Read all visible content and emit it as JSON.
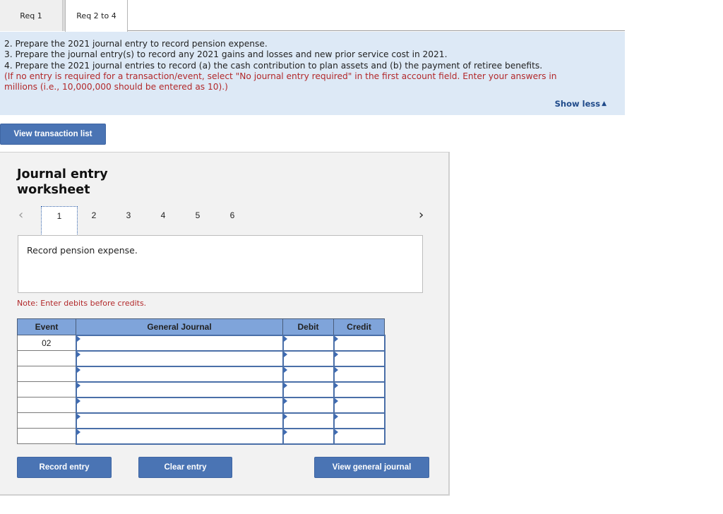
{
  "tabs": [
    {
      "label": "Req 1",
      "active": false
    },
    {
      "label": "Req 2 to 4",
      "active": true
    }
  ],
  "instructions": {
    "lines": [
      "2. Prepare the 2021 journal entry to record pension expense.",
      "3. Prepare the journal entry(s) to record any 2021 gains and losses and new prior service cost in 2021.",
      "4. Prepare the 2021 journal entries to record (a) the cash contribution to plan assets and (b) the payment of retiree benefits."
    ],
    "note_line1": "(If no entry is required for a transaction/event, select \"No journal entry required\" in the first account field. Enter your answers in",
    "note_line2": "millions (i.e., 10,000,000 should be entered as 10).)",
    "show_less_label": "Show less",
    "show_less_icon": "triangle-up-icon"
  },
  "view_transaction_list_label": "View transaction list",
  "worksheet": {
    "title": "Journal entry worksheet",
    "pager": {
      "prev_icon": "chevron-left-icon",
      "next_icon": "chevron-right-icon",
      "pages": [
        "1",
        "2",
        "3",
        "4",
        "5",
        "6"
      ],
      "active_page": "1"
    },
    "description": "Record pension expense.",
    "note": "Note: Enter debits before credits.",
    "table": {
      "headers": {
        "event": "Event",
        "general_journal": "General Journal",
        "debit": "Debit",
        "credit": "Credit"
      },
      "rows": [
        {
          "event": "02",
          "account": "",
          "debit": "",
          "credit": ""
        },
        {
          "event": "",
          "account": "",
          "debit": "",
          "credit": ""
        },
        {
          "event": "",
          "account": "",
          "debit": "",
          "credit": ""
        },
        {
          "event": "",
          "account": "",
          "debit": "",
          "credit": ""
        },
        {
          "event": "",
          "account": "",
          "debit": "",
          "credit": ""
        },
        {
          "event": "",
          "account": "",
          "debit": "",
          "credit": ""
        },
        {
          "event": "",
          "account": "",
          "debit": "",
          "credit": ""
        }
      ]
    },
    "buttons": {
      "record_entry": "Record entry",
      "clear_entry": "Clear entry",
      "view_general_journal": "View general journal"
    }
  },
  "colors": {
    "button_blue": "#4a74b4",
    "instructions_bg": "#dde9f6",
    "note_red": "#b2282a",
    "table_header": "#7fa4da",
    "link_blue": "#1f4a8a"
  }
}
